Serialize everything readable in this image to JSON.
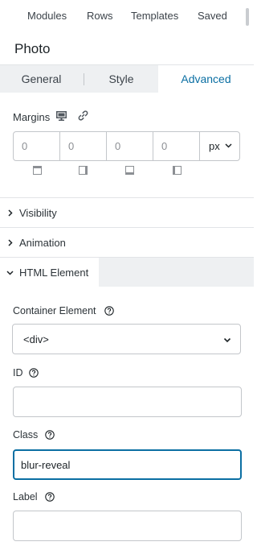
{
  "top_tabs": [
    "Modules",
    "Rows",
    "Templates",
    "Saved"
  ],
  "panel_title": "Photo",
  "settings_tabs": [
    "General",
    "Style",
    "Advanced"
  ],
  "active_settings_tab": "Advanced",
  "margins": {
    "label": "Margins",
    "values": [
      "0",
      "0",
      "0",
      "0"
    ],
    "unit": "px"
  },
  "sections": [
    {
      "label": "Visibility",
      "open": false
    },
    {
      "label": "Animation",
      "open": false
    },
    {
      "label": "HTML Element",
      "open": true
    }
  ],
  "fields": {
    "container_element": {
      "label": "Container Element",
      "value": "<div>"
    },
    "id": {
      "label": "ID",
      "value": ""
    },
    "class": {
      "label": "Class",
      "value": "blur-reveal"
    },
    "label": {
      "label": "Label",
      "value": ""
    }
  },
  "colors": {
    "accent": "#0b6fa3",
    "tab_bg": "#eef0f2",
    "border": "#c3c6ca"
  }
}
